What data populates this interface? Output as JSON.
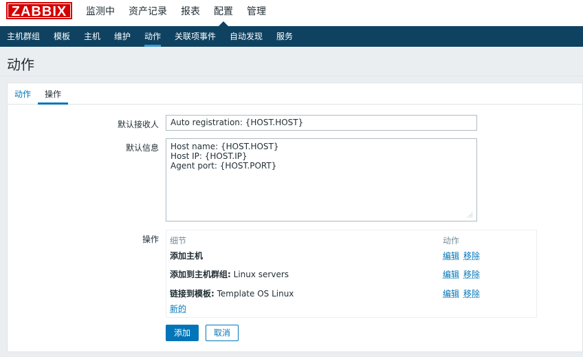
{
  "header": {
    "logo": "ZABBIX",
    "main_menu": [
      "监测中",
      "资产记录",
      "报表",
      "配置",
      "管理"
    ],
    "active_main": "配置"
  },
  "sub_menu": {
    "items": [
      "主机群组",
      "模板",
      "主机",
      "维护",
      "动作",
      "关联项事件",
      "自动发现",
      "服务"
    ],
    "active": "动作"
  },
  "page": {
    "title": "动作"
  },
  "tabs": {
    "items": [
      "动作",
      "操作"
    ],
    "active": "操作"
  },
  "form": {
    "default_recipient_label": "默认接收人",
    "default_recipient_value": "Auto registration: {HOST.HOST}",
    "default_message_label": "默认信息",
    "default_message_value": "Host name: {HOST.HOST}\nHost IP: {HOST.IP}\nAgent port: {HOST.PORT}",
    "operations_label": "操作",
    "operations": {
      "col_details": "细节",
      "col_action": "动作",
      "rows": [
        {
          "bold": "添加主机",
          "text": "",
          "edit": "编辑",
          "remove": "移除"
        },
        {
          "bold": "添加到主机群组:",
          "text": " Linux servers",
          "edit": "编辑",
          "remove": "移除"
        },
        {
          "bold": "链接到模板:",
          "text": " Template OS Linux",
          "edit": "编辑",
          "remove": "移除"
        }
      ],
      "new_link": "新的"
    },
    "add_button": "添加",
    "cancel_button": "取消"
  },
  "colors": {
    "brand": "#d40000",
    "nav": "#0f4261",
    "link": "#0275b8",
    "accent": "#3a97d1"
  }
}
